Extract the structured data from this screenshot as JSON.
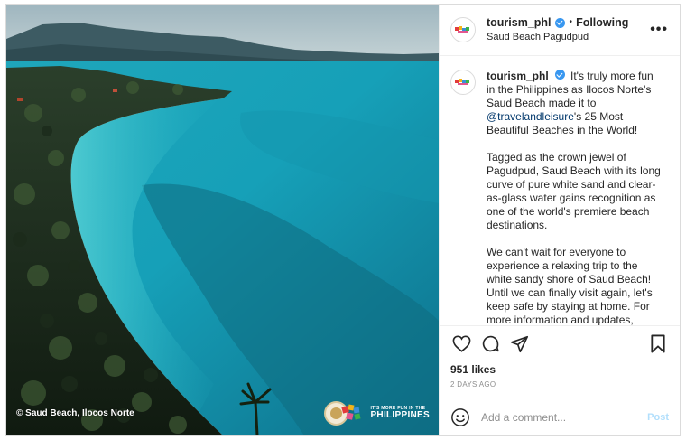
{
  "post": {
    "photo_credit": "© Saud Beach, Ilocos Norte",
    "brand_small": "IT'S MORE FUN IN THE",
    "brand_big": "PHILIPPINES",
    "icons": {
      "verified": "verified-badge-icon",
      "more": "more-options-icon",
      "like": "heart-icon",
      "comment": "comment-bubble-icon",
      "share": "paper-plane-icon",
      "save": "bookmark-icon",
      "emoji": "smiley-icon"
    }
  },
  "header": {
    "username": "tourism_phl",
    "separator": "•",
    "follow_status": "Following",
    "location": "Saud Beach Pagudpud",
    "more": "•••"
  },
  "caption": {
    "username": "tourism_phl",
    "p1_before": "It's truly more fun in the Philippines as Ilocos Norte's Saud Beach made it to ",
    "mention": "@travelandleisure",
    "p1_after": "'s 25 Most Beautiful Beaches in the World!",
    "p2": "Tagged as the crown jewel of Pagudpud, Saud Beach with its long curve of pure white sand and clear-as-glass water gains recognition as one of the world's premiere beach destinations.",
    "p3": "We can't wait for everyone to experience a relaxing trip to the white sandy shore of Saud Beach! Until we can finally visit again, let's keep safe by staying at home. For more information and updates, check"
  },
  "stats": {
    "likes": "951 likes",
    "timestamp": "2 DAYS AGO"
  },
  "comment": {
    "placeholder": "Add a comment...",
    "post_label": "Post"
  },
  "colors": {
    "verified": "#3897f0",
    "mention": "#00376b",
    "post_disabled": "#b2dffc",
    "secondary_text": "#8e8e8e"
  }
}
